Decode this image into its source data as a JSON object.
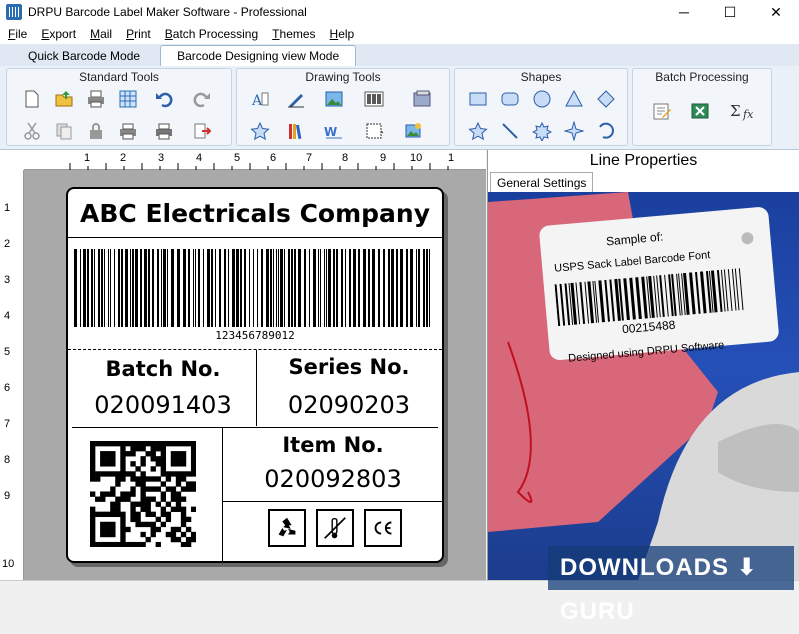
{
  "window": {
    "title": "DRPU Barcode Label Maker Software - Professional",
    "minimize": "─",
    "maximize": "☐",
    "close": "✕"
  },
  "menu": [
    "File",
    "Export",
    "Mail",
    "Print",
    "Batch Processing",
    "Themes",
    "Help"
  ],
  "mode_tabs": [
    {
      "label": "Quick Barcode Mode",
      "active": false
    },
    {
      "label": "Barcode Designing view Mode",
      "active": true
    }
  ],
  "ribbon_groups": {
    "standard": "Standard Tools",
    "drawing": "Drawing Tools",
    "shapes": "Shapes",
    "batch": "Batch Processing"
  },
  "ruler_top": [
    "1",
    "2",
    "3",
    "4",
    "5",
    "6",
    "7",
    "8",
    "9",
    "10",
    "1"
  ],
  "ruler_left": [
    "1",
    "2",
    "3",
    "4",
    "5",
    "6",
    "7",
    "8",
    "9",
    "10"
  ],
  "label": {
    "company": "ABC Electricals Company",
    "barcode_number": "123456789012",
    "batch_heading": "Batch No.",
    "batch_value": "020091403",
    "series_heading": "Series No.",
    "series_value": "02090203",
    "item_heading": "Item No.",
    "item_value": "020092803"
  },
  "properties": {
    "title": "Line Properties",
    "tab": "General Settings",
    "photo_text": {
      "line1": "Sample of:",
      "line2": "USPS Sack Label Barcode Font",
      "number": "00215488",
      "designed": "Designed using DRPU Software"
    }
  },
  "watermark": "DOWNLOADS ⬇ GURU"
}
